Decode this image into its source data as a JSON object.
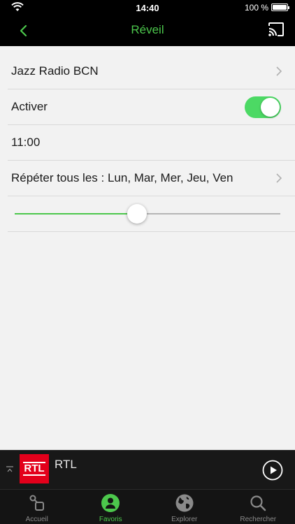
{
  "status_bar": {
    "time": "14:40",
    "battery": "100 %"
  },
  "nav": {
    "title": "Réveil"
  },
  "settings": {
    "station": "Jazz Radio BCN",
    "activate_label": "Activer",
    "activate_on": true,
    "time": "11:00",
    "repeat_label": "Répéter tous les : Lun, Mar, Mer, Jeu, Ven",
    "volume_fraction": 0.46
  },
  "player": {
    "station": "RTL",
    "logo_text": "RTL"
  },
  "tabs": [
    {
      "label": "Accueil"
    },
    {
      "label": "Favoris"
    },
    {
      "label": "Explorer"
    },
    {
      "label": "Rechercher"
    }
  ],
  "colors": {
    "accent": "#4cc74c",
    "toggle_on": "#4cd964",
    "rtl_red": "#e3001b"
  }
}
